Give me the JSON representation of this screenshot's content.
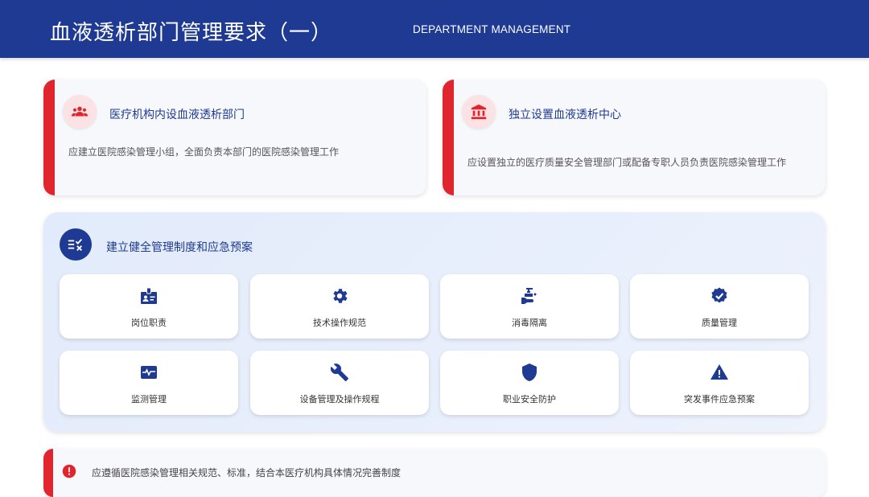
{
  "header": {
    "title": "血液透析部门管理要求（一）",
    "subtitle": "DEPARTMENT MANAGEMENT"
  },
  "cards": [
    {
      "icon": "group-icon",
      "title": "医疗机构内设血液透析部门",
      "description": "应建立医院感染管理小组，全面负责本部门的医院感染管理工作"
    },
    {
      "icon": "institution-icon",
      "title": "独立设置血液透析中心",
      "description": "应设置独立的医疗质量安全管理部门或配备专职人员负责医院感染管理工作"
    }
  ],
  "system": {
    "icon": "checklist-icon",
    "title": "建立健全管理制度和应急预案",
    "items": [
      {
        "icon": "badge-icon",
        "label": "岗位职责"
      },
      {
        "icon": "gear-icon",
        "label": "技术操作规范"
      },
      {
        "icon": "sanitizer-icon",
        "label": "消毒隔离"
      },
      {
        "icon": "verified-icon",
        "label": "质量管理"
      },
      {
        "icon": "monitor-heart-icon",
        "label": "监测管理"
      },
      {
        "icon": "wrench-icon",
        "label": "设备管理及操作规程"
      },
      {
        "icon": "shield-icon",
        "label": "职业安全防护"
      },
      {
        "icon": "warning-icon",
        "label": "突发事件应急预案"
      }
    ]
  },
  "notice": {
    "icon": "info-icon",
    "text": "应遵循医院感染管理相关规范、标准，结合本医疗机构具体情况完善制度"
  },
  "colors": {
    "primary": "#1e3a93",
    "accent": "#e0252f",
    "icon_bg": "#fbe2e4"
  }
}
